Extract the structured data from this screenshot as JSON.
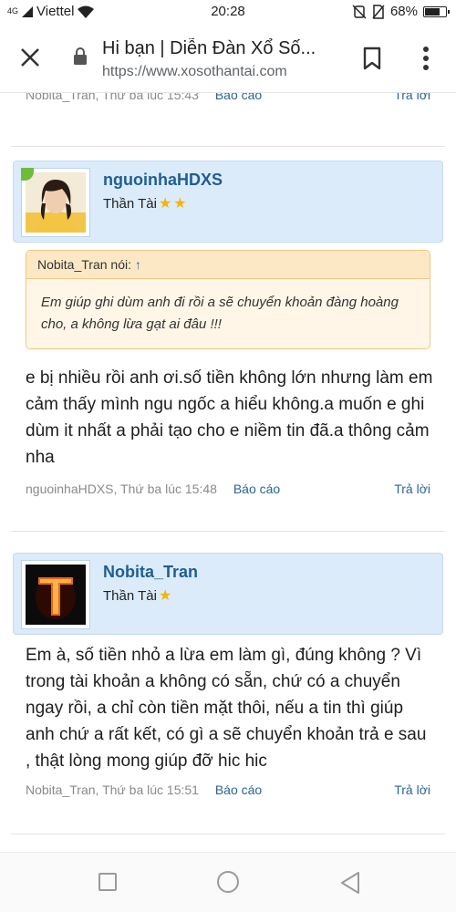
{
  "status_bar": {
    "carrier": "Viettel",
    "signal_label": "4G",
    "time": "20:28",
    "battery": "68%"
  },
  "browser": {
    "page_title": "Hi bạn | Diễn Đàn Xổ Số...",
    "url": "https://www.xosothantai.com"
  },
  "posts": [
    {
      "author": "Nobita_Tran",
      "timestamp": "Thứ ba lúc 15:43",
      "report_label": "Báo cáo",
      "reply_label": "Trả lời"
    },
    {
      "author": "nguoinhaHDXS",
      "rank": "Thần Tài",
      "rank_stars": 2,
      "quote": {
        "author_line": "Nobita_Tran nói:",
        "arrow": "↑",
        "text": "Em giúp ghi dùm anh đi rồi a sẽ chuyển khoản đàng hoàng cho, a không lừa gạt ai đâu !!!"
      },
      "message": "e bị nhiều rồi anh ơi.số tiền không lớn nhưng làm em cảm thấy mình ngu ngốc a hiểu không.a muốn e ghi dùm it nhất a phải tạo cho e niềm tin đã.a thông cảm nha",
      "timestamp": "Thứ ba lúc 15:48",
      "report_label": "Báo cáo",
      "reply_label": "Trả lời"
    },
    {
      "author": "Nobita_Tran",
      "rank": "Thần Tài",
      "rank_stars": 1,
      "message": "Em à, số tiền nhỏ a lừa em làm gì, đúng không ? Vì trong tài khoản a không có sẵn, chứ có a chuyển ngay rồi, a chỉ còn tiền mặt thôi, nếu a tin thì giúp anh chứ a rất kết, có gì a sẽ chuyển khoản trả e sau , thật lòng mong giúp đỡ hic hic",
      "timestamp": "Thứ ba lúc 15:51",
      "report_label": "Báo cáo",
      "reply_label": "Trả lời"
    }
  ],
  "icons": {
    "close": "close-icon",
    "lock": "lock-icon",
    "bookmark": "bookmark-icon",
    "menu": "more-vert-icon",
    "nav_recent": "square-icon",
    "nav_home": "circle-icon",
    "nav_back": "triangle-back-icon"
  }
}
